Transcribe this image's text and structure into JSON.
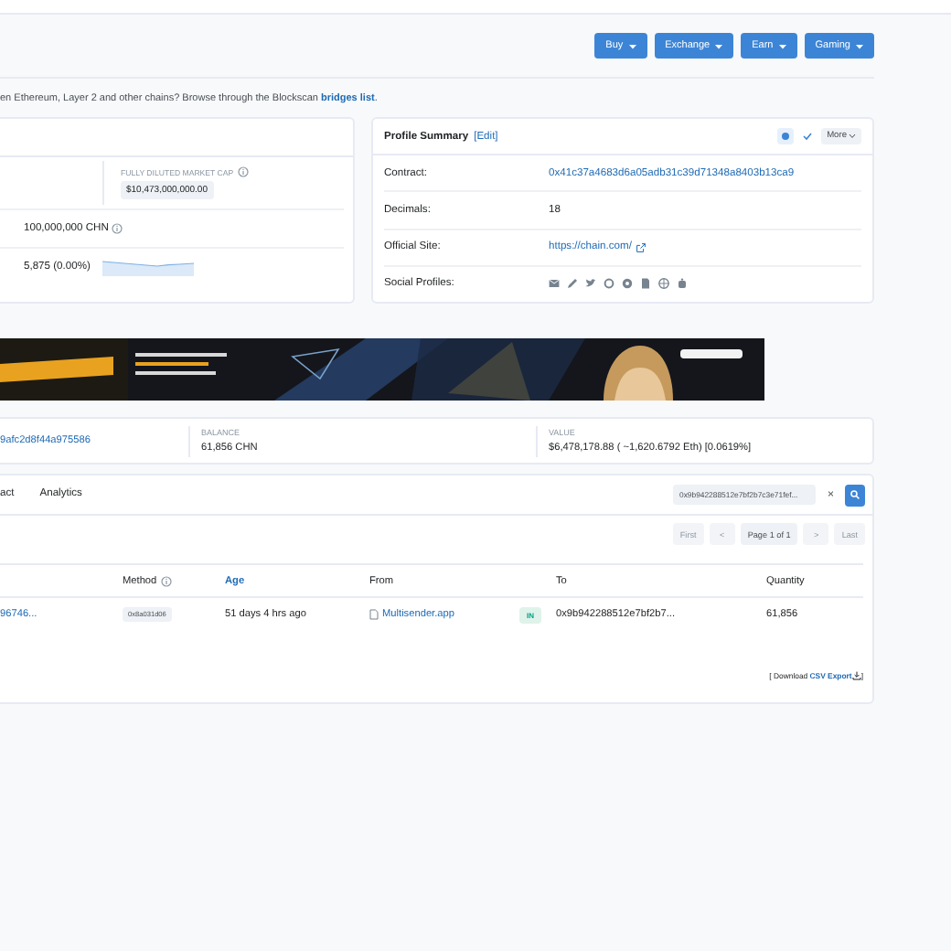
{
  "toolbar": {
    "buttons": [
      {
        "label": "Buy"
      },
      {
        "label": "Exchange"
      },
      {
        "label": "Earn"
      },
      {
        "label": "Gaming"
      }
    ]
  },
  "notice": {
    "text": "en Ethereum, Layer 2 and other chains? Browse through the Blockscan",
    "link": "bridges list",
    "end": "."
  },
  "overview": {
    "market_cap_label": "FULLY DILUTED MARKET CAP",
    "market_cap": "$10,473,000,000.00",
    "supply": "100,000,000 CHN",
    "holders": "5,875 (0.00%)"
  },
  "profile": {
    "title": "Profile Summary",
    "edit": "[Edit]",
    "more": "More",
    "rows": [
      {
        "label": "Contract:",
        "value": "0x41c37a4683d6a05adb31c39d71348a8403b13ca9",
        "kind": "link"
      },
      {
        "label": "Decimals:",
        "value": "18",
        "kind": "text"
      },
      {
        "label": "Official Site:",
        "value": "https://chain.com/",
        "kind": "external"
      },
      {
        "label": "Social Profiles:",
        "kind": "icons"
      }
    ]
  },
  "holding": {
    "address": "9afc2d8f44a975586",
    "balance_label": "BALANCE",
    "balance": "61,856 CHN",
    "value_label": "VALUE",
    "value": "$6,478,178.88 ( ~1,620.6792 Eth) [0.0619%]"
  },
  "tabs": [
    {
      "label": "act",
      "selected": false
    },
    {
      "label": "Analytics",
      "selected": false
    }
  ],
  "filter": {
    "value": "0x9b942288512e7bf2b7c3e71fef...",
    "clear": "×"
  },
  "pagination": [
    {
      "label": "First",
      "disabled": true
    },
    {
      "label": "<",
      "disabled": true
    },
    {
      "label": "Page 1 of 1",
      "disabled": false
    },
    {
      "label": ">",
      "disabled": true
    },
    {
      "label": "Last",
      "disabled": true
    }
  ],
  "table": {
    "columns": [
      {
        "label": "Method",
        "kind": "info"
      },
      {
        "label": "Age",
        "kind": "link"
      },
      {
        "label": "From",
        "kind": "plain"
      },
      {
        "label": "To",
        "kind": "plain"
      },
      {
        "label": "Quantity",
        "kind": "plain"
      }
    ],
    "rows": [
      {
        "hash": "96746...",
        "method": "0x8a031d06",
        "age": "51 days 4 hrs ago",
        "from": "Multisender.app",
        "direction": "IN",
        "to": "0x9b942288512e7bf2b7...",
        "quantity": "61,856"
      }
    ]
  },
  "export": {
    "prefix": "[ Download",
    "link": "CSV Export",
    "suffix": "]"
  }
}
